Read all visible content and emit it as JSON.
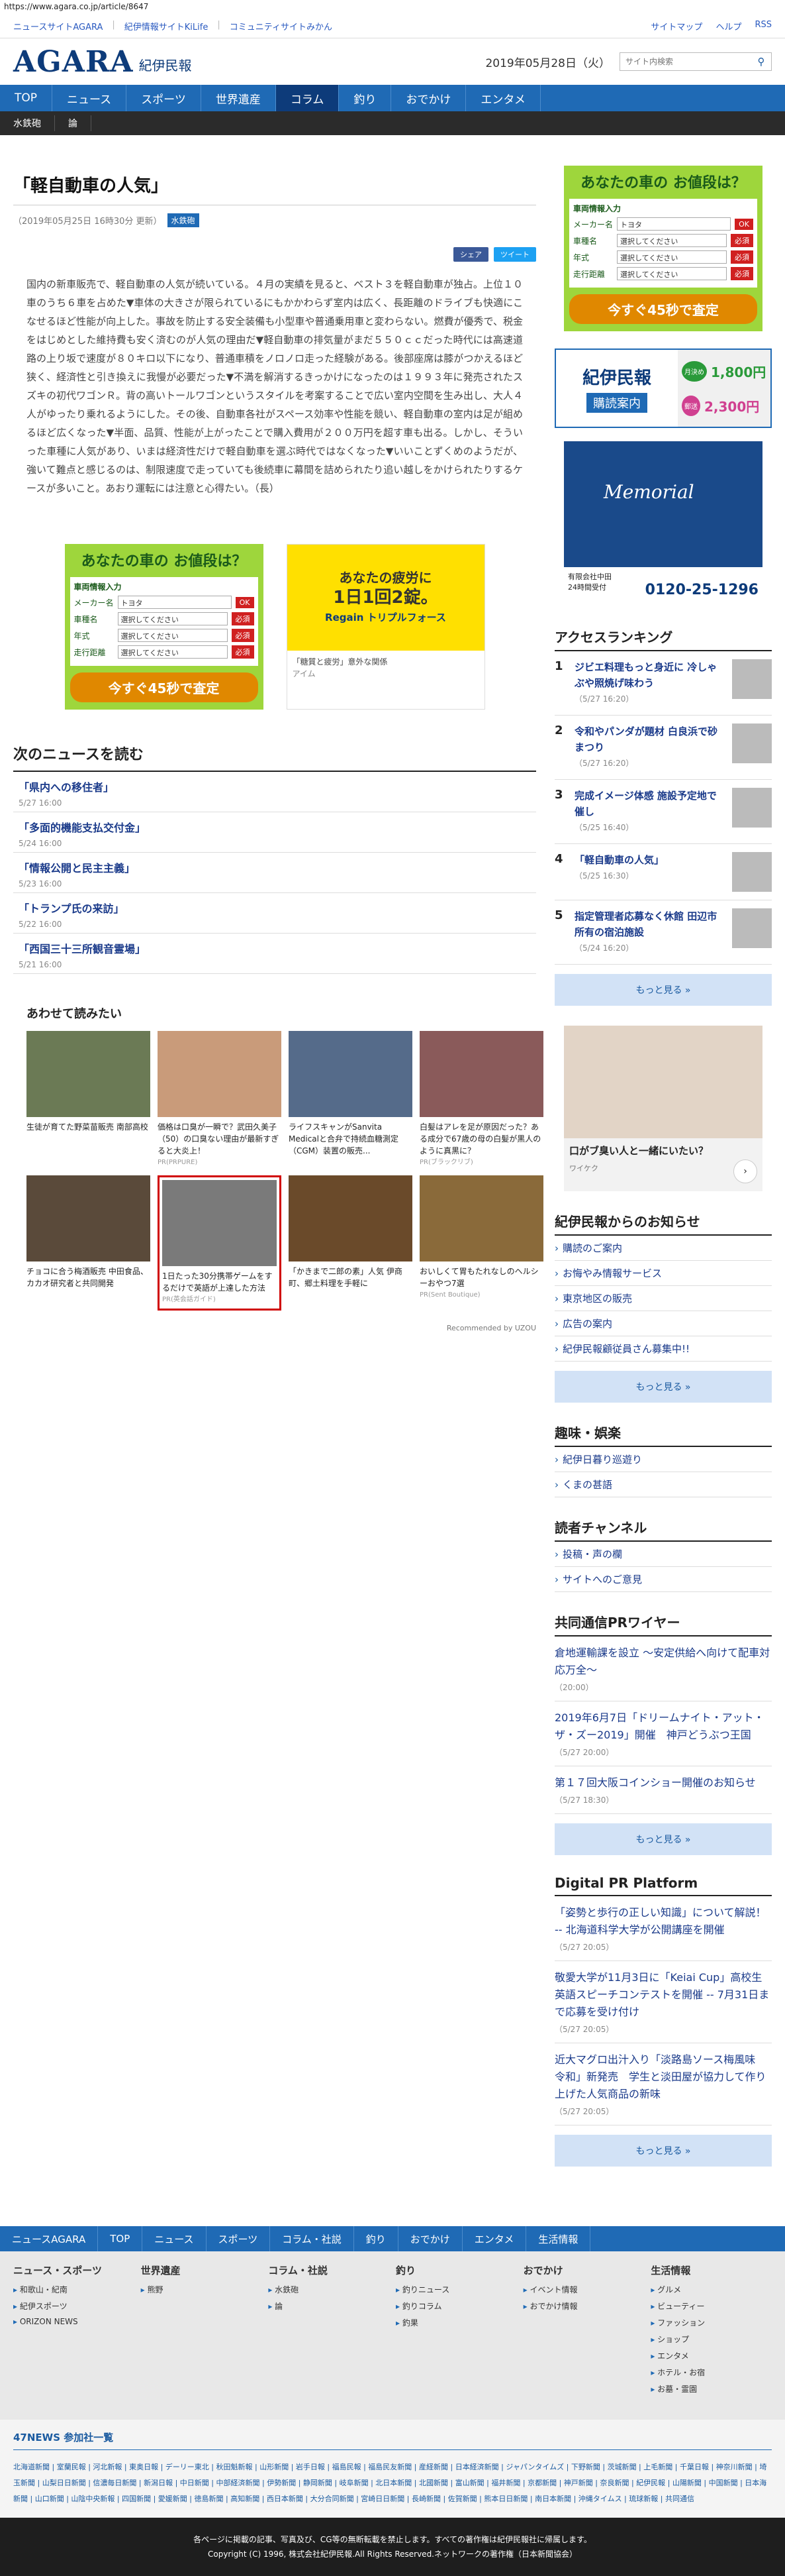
{
  "url": "https://www.agara.co.jp/article/8647",
  "top_links": [
    "ニュースサイトAGARA",
    "紀伊情報サイトKiLife",
    "コミュニティサイトみかん"
  ],
  "top_right": [
    "サイトマップ",
    "ヘルプ",
    "RSS"
  ],
  "logo": "AGARA",
  "logo_sub": "紀伊民報",
  "header_date": "2019年05月28日（火）",
  "search_placeholder": "サイト内検索",
  "nav": [
    "TOP",
    "ニュース",
    "スポーツ",
    "世界遺産",
    "コラム",
    "釣り",
    "おでかけ",
    "エンタメ"
  ],
  "subnav": [
    "水鉄砲",
    "論"
  ],
  "article": {
    "title": "「軽自動車の人気」",
    "meta": "（2019年05月25日 16時30分 更新）",
    "badge": "水鉄砲",
    "share_fb": "シェア",
    "share_tw": "ツイート",
    "body": "国内の新車販売で、軽自動車の人気が続いている。４月の実績を見ると、ベスト３を軽自動車が独占。上位１０車のうち６車を占めた▼車体の大きさが限られているにもかかわらず室内は広く、長距離のドライブも快適にこなせるほど性能が向上した。事故を防止する安全装備も小型車や普通乗用車と変わらない。燃費が優秀で、税金をはじめとした維持費も安く済むのが人気の理由だ▼軽自動車の排気量がまだ５５０ｃｃだった時代には高速道路の上り坂で速度が８０キロ以下になり、普通車積をノロノロ走った経験がある。後部座席は膝がつかえるほど狭く、経済性と引き換えに我慢が必要だった▼不満を解消するきっかけになったのは１９９３年に発売されたスズキの初代ワゴンＲ。背の高いトールワゴンというスタイルを考案することで広い室内空間を生み出し、大人４人がゆったり乗れるようにした。その後、自動車各社がスペース効率や性能を競い、軽自動車の室内は足が組めるほど広くなった▼半面、品質、性能が上がったことで購入費用が２００万円を超す車も出る。しかし、そういった車種に人気があり、いまは経済性だけで軽自動車を選ぶ時代ではなくなった▼いいことずくめのようだが、強いて難点と感じるのは、制限速度で走っていても後続車に幕間を詰められたり追い越しをかけられたりするケースが多いこと。あおり運転には注意と心得たい。（長）"
  },
  "car_ad": {
    "title": "あなたの車の お値段は？",
    "section": "車両情報入力",
    "rows": [
      {
        "k": "メーカー名",
        "v": "トヨタ",
        "b": "OK"
      },
      {
        "k": "車種名",
        "v": "選択してください",
        "b": "必須"
      },
      {
        "k": "年式",
        "v": "選択してください",
        "b": "必須"
      },
      {
        "k": "走行距離",
        "v": "選択してください",
        "b": "必須"
      }
    ],
    "button": "今すぐ45秒で査定"
  },
  "reg_ad": {
    "head1": "あなたの疲労に",
    "head2": "1日1回2錠。",
    "brand": "Regain トリプルフォース",
    "cap": "「糖質と疲労」意外な関係",
    "sub": "アイム"
  },
  "next_news_title": "次のニュースを読む",
  "next_news": [
    {
      "t": "「県内への移住者」",
      "d": "5/27 16:00"
    },
    {
      "t": "「多面的機能支払交付金」",
      "d": "5/24 16:00"
    },
    {
      "t": "「情報公開と民主主義」",
      "d": "5/23 16:00"
    },
    {
      "t": "「トランプ氏の来訪」",
      "d": "5/22 16:00"
    },
    {
      "t": "「西国三十三所観音霊場」",
      "d": "5/21 16:00"
    }
  ],
  "related_title": "あわせて読みたい",
  "related": [
    {
      "t": "生徒が育てた野菜苗販売 南部高校",
      "pr": "",
      "c": "#6b7a55"
    },
    {
      "t": "価格は口臭が一瞬で？武田久美子（50）の口臭ない理由が最新すぎると大炎上！",
      "pr": "PR(PRPURE)",
      "c": "#c99b7a"
    },
    {
      "t": "ライフスキャンがSanvita Medicalと合弁で持続血糖測定（CGM）装置の販売...",
      "pr": "",
      "c": "#556b8a"
    },
    {
      "t": "白髪はアレを足が原因だった？ある成分で67歳の母の白髪が黒人のように真黒に？",
      "pr": "PR(ブラックリブ)",
      "c": "#8a5a5a"
    },
    {
      "t": "チョコに合う梅酒販売 中田食品、カカオ研究者と共同開発",
      "pr": "",
      "c": "#5a4a3a"
    },
    {
      "t": "1日たった30分携帯ゲームをするだけで英語が上達した方法",
      "pr": "PR(英会話ガイド)",
      "c": "#7a7a7a"
    },
    {
      "t": "「かきまで二郎の素」人気 伊商町、郷土料理を手軽に",
      "pr": "",
      "c": "#6a4a2a"
    },
    {
      "t": "おいしくて胃もたれなしのヘルシーおやつ7選",
      "pr": "PR(Sent Boutique)",
      "c": "#8a6a3a"
    }
  ],
  "uzou": "Recommended by UZOU",
  "side_paper": {
    "title": "紀伊民報",
    "sub": "購読案内",
    "p1": "1,800円",
    "p2": "2,300円",
    "l1": "月決め",
    "l2": "郵送"
  },
  "side_memorial": {
    "title": "Memorial",
    "tel": "0120-25-1296",
    "name": "有限会社中田",
    "sub": "24時間受付"
  },
  "ranking_title": "アクセスランキング",
  "ranking": [
    {
      "n": "1",
      "t": "ジビエ料理もっと身近に 冷しゃぶや照焼げ味わう",
      "d": "（5/27 16:20）"
    },
    {
      "n": "2",
      "t": "令和やパンダが題材 白良浜で砂まつり",
      "d": "（5/27 16:20）"
    },
    {
      "n": "3",
      "t": "完成イメージ体感 施設予定地で催し",
      "d": "（5/25 16:40）"
    },
    {
      "n": "4",
      "t": "「軽自動車の人気」",
      "d": "（5/25 16:30）"
    },
    {
      "n": "5",
      "t": "指定管理者応募なく休館 田辺市所有の宿泊施設",
      "d": "（5/24 16:20）"
    }
  ],
  "more_label": "もっと見る »",
  "side_ad2": {
    "title": "口がブ臭い人と一緒にいたい？",
    "sub": "ワイケク"
  },
  "notice_title": "紀伊民報からのお知らせ",
  "notices": [
    "購読のご案内",
    "お悔やみ情報サービス",
    "東京地区の販売",
    "広告の案内",
    "紀伊民報顧従員さん募集中!!"
  ],
  "hobby_title": "趣味・娯楽",
  "hobby": [
    "紀伊日暮り巡遊り",
    "くまの甚語"
  ],
  "reader_title": "読者チャンネル",
  "reader": [
    "投稿・声の欄",
    "サイトへのご意見"
  ],
  "pr_title": "共同通信PRワイヤー",
  "pr_items": [
    {
      "t": "倉地運輸課を設立 〜安定供給へ向けて配車対応万全〜",
      "d": "（20:00）"
    },
    {
      "t": "2019年6月7日「ドリームナイト・アット・ザ・ズー2019」開催　神戸どうぶつ王国",
      "d": "（5/27 20:00）"
    },
    {
      "t": "第１７回大阪コインショー開催のお知らせ",
      "d": "（5/27 18:30）"
    }
  ],
  "dpr_title": "Digital PR Platform",
  "dpr_items": [
    {
      "t": "「姿勢と歩行の正しい知識」について解説！ -- 北海道科学大学が公開講座を開催",
      "d": "（5/27 20:05）"
    },
    {
      "t": "敬愛大学が11月3日に「Keiai Cup」高校生英語スピーチコンテストを開催 -- 7月31日まで応募を受け付け",
      "d": "（5/27 20:05）"
    },
    {
      "t": "近大マグロ出汁入り「淡路島ソース梅風味　令和」新発売　学生と淡田屋が協力して作り上げた人気商品の新味",
      "d": "（5/27 20:05）"
    }
  ],
  "footer_nav": [
    "ニュースAGARA",
    "TOP",
    "ニュース",
    "スポーツ",
    "コラム・社説",
    "釣り",
    "おでかけ",
    "エンタメ",
    "生活情報"
  ],
  "footer_cols": [
    {
      "h": "ニュース・スポーツ",
      "i": [
        "和歌山・紀南",
        "紀伊スポーツ",
        "ORIZON NEWS"
      ]
    },
    {
      "h": "世界遺産",
      "i": [
        "熊野"
      ]
    },
    {
      "h": "コラム・社説",
      "i": [
        "水鉄砲",
        "論"
      ]
    },
    {
      "h": "釣り",
      "i": [
        "釣りニュース",
        "釣りコラム",
        "釣果"
      ]
    },
    {
      "h": "おでかけ",
      "i": [
        "イベント情報",
        "おでかけ情報"
      ]
    },
    {
      "h": "生活情報",
      "i": [
        "グルメ",
        "ビューティー",
        "ファッション",
        "ショップ",
        "エンタメ",
        "ホテル・お宿",
        "お墓・霊園"
      ]
    }
  ],
  "news47_title": "47NEWS 参加社一覧",
  "news47_list": "北海道新聞 | 室蘭民報 | 河北新報 | 東奥日報 | デーリー東北 | 秋田魁新報 | 山形新聞 | 岩手日報 | 福島民報 | 福島民友新聞 | 産経新聞 | 日本経済新聞 | ジャパンタイムズ | 下野新聞 | 茨城新聞 | 上毛新聞 | 千葉日報 | 神奈川新聞 | 埼玉新聞 | 山梨日日新聞 | 信濃毎日新聞 | 新潟日報 | 中日新聞 | 中部経済新聞 | 伊勢新聞 | 静岡新聞 | 岐阜新聞 | 北日本新聞 | 北國新聞 | 富山新聞 | 福井新聞 | 京都新聞 | 神戸新聞 | 奈良新聞 | 紀伊民報 | 山陽新聞 | 中国新聞 | 日本海新聞 | 山口新聞 | 山陰中央新報 | 四国新聞 | 愛媛新聞 | 徳島新聞 | 高知新聞 | 西日本新聞 | 大分合同新聞 | 宮崎日日新聞 | 長崎新聞 | 佐賀新聞 | 熊本日日新聞 | 南日本新聞 | 沖縄タイムス | 琉球新報 | 共同通信",
  "copyright1": "各ページに掲載の記事、写真及び、CG等の無断転載を禁止します。すべての著作権は紀伊民報社に帰属します。",
  "copyright2": "Copyright (C) 1996, 株式会社紀伊民報.All Rights Reserved.ネットワークの著作権（日本新聞協会）"
}
